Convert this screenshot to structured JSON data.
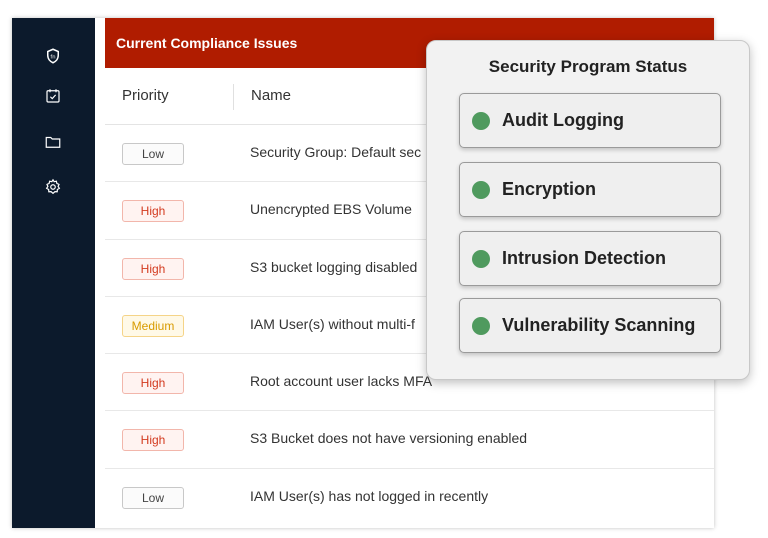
{
  "sidebar": {
    "icons": [
      {
        "name": "shield-icon"
      },
      {
        "name": "calendar-check-icon"
      },
      {
        "name": "folder-icon"
      },
      {
        "name": "gear-icon"
      }
    ]
  },
  "panel": {
    "title": "Current Compliance Issues",
    "columns": [
      "Priority",
      "Name"
    ],
    "rows": [
      {
        "priority": "Low",
        "level": "low",
        "name": "Security Group: Default sec"
      },
      {
        "priority": "High",
        "level": "high",
        "name": "Unencrypted EBS Volume"
      },
      {
        "priority": "High",
        "level": "high",
        "name": "S3 bucket logging disabled"
      },
      {
        "priority": "Medium",
        "level": "medium",
        "name": "IAM User(s) without multi-f"
      },
      {
        "priority": "High",
        "level": "high",
        "name": "Root account user lacks MFA"
      },
      {
        "priority": "High",
        "level": "high",
        "name": "S3 Bucket does not have versioning enabled"
      },
      {
        "priority": "Low",
        "level": "low",
        "name": "IAM User(s) has not logged in recently"
      }
    ]
  },
  "status": {
    "title": "Security Program Status",
    "items": [
      {
        "label": "Audit Logging",
        "state_color": "#4f9a5e"
      },
      {
        "label": "Encryption",
        "state_color": "#4f9a5e"
      },
      {
        "label": "Intrusion Detection",
        "state_color": "#4f9a5e"
      },
      {
        "label": "Vulnerability Scanning",
        "state_color": "#4f9a5e"
      }
    ]
  },
  "colors": {
    "sidebar_bg": "#0c1a2c",
    "header_red": "#b01c00",
    "status_green": "#4f9a5e"
  }
}
